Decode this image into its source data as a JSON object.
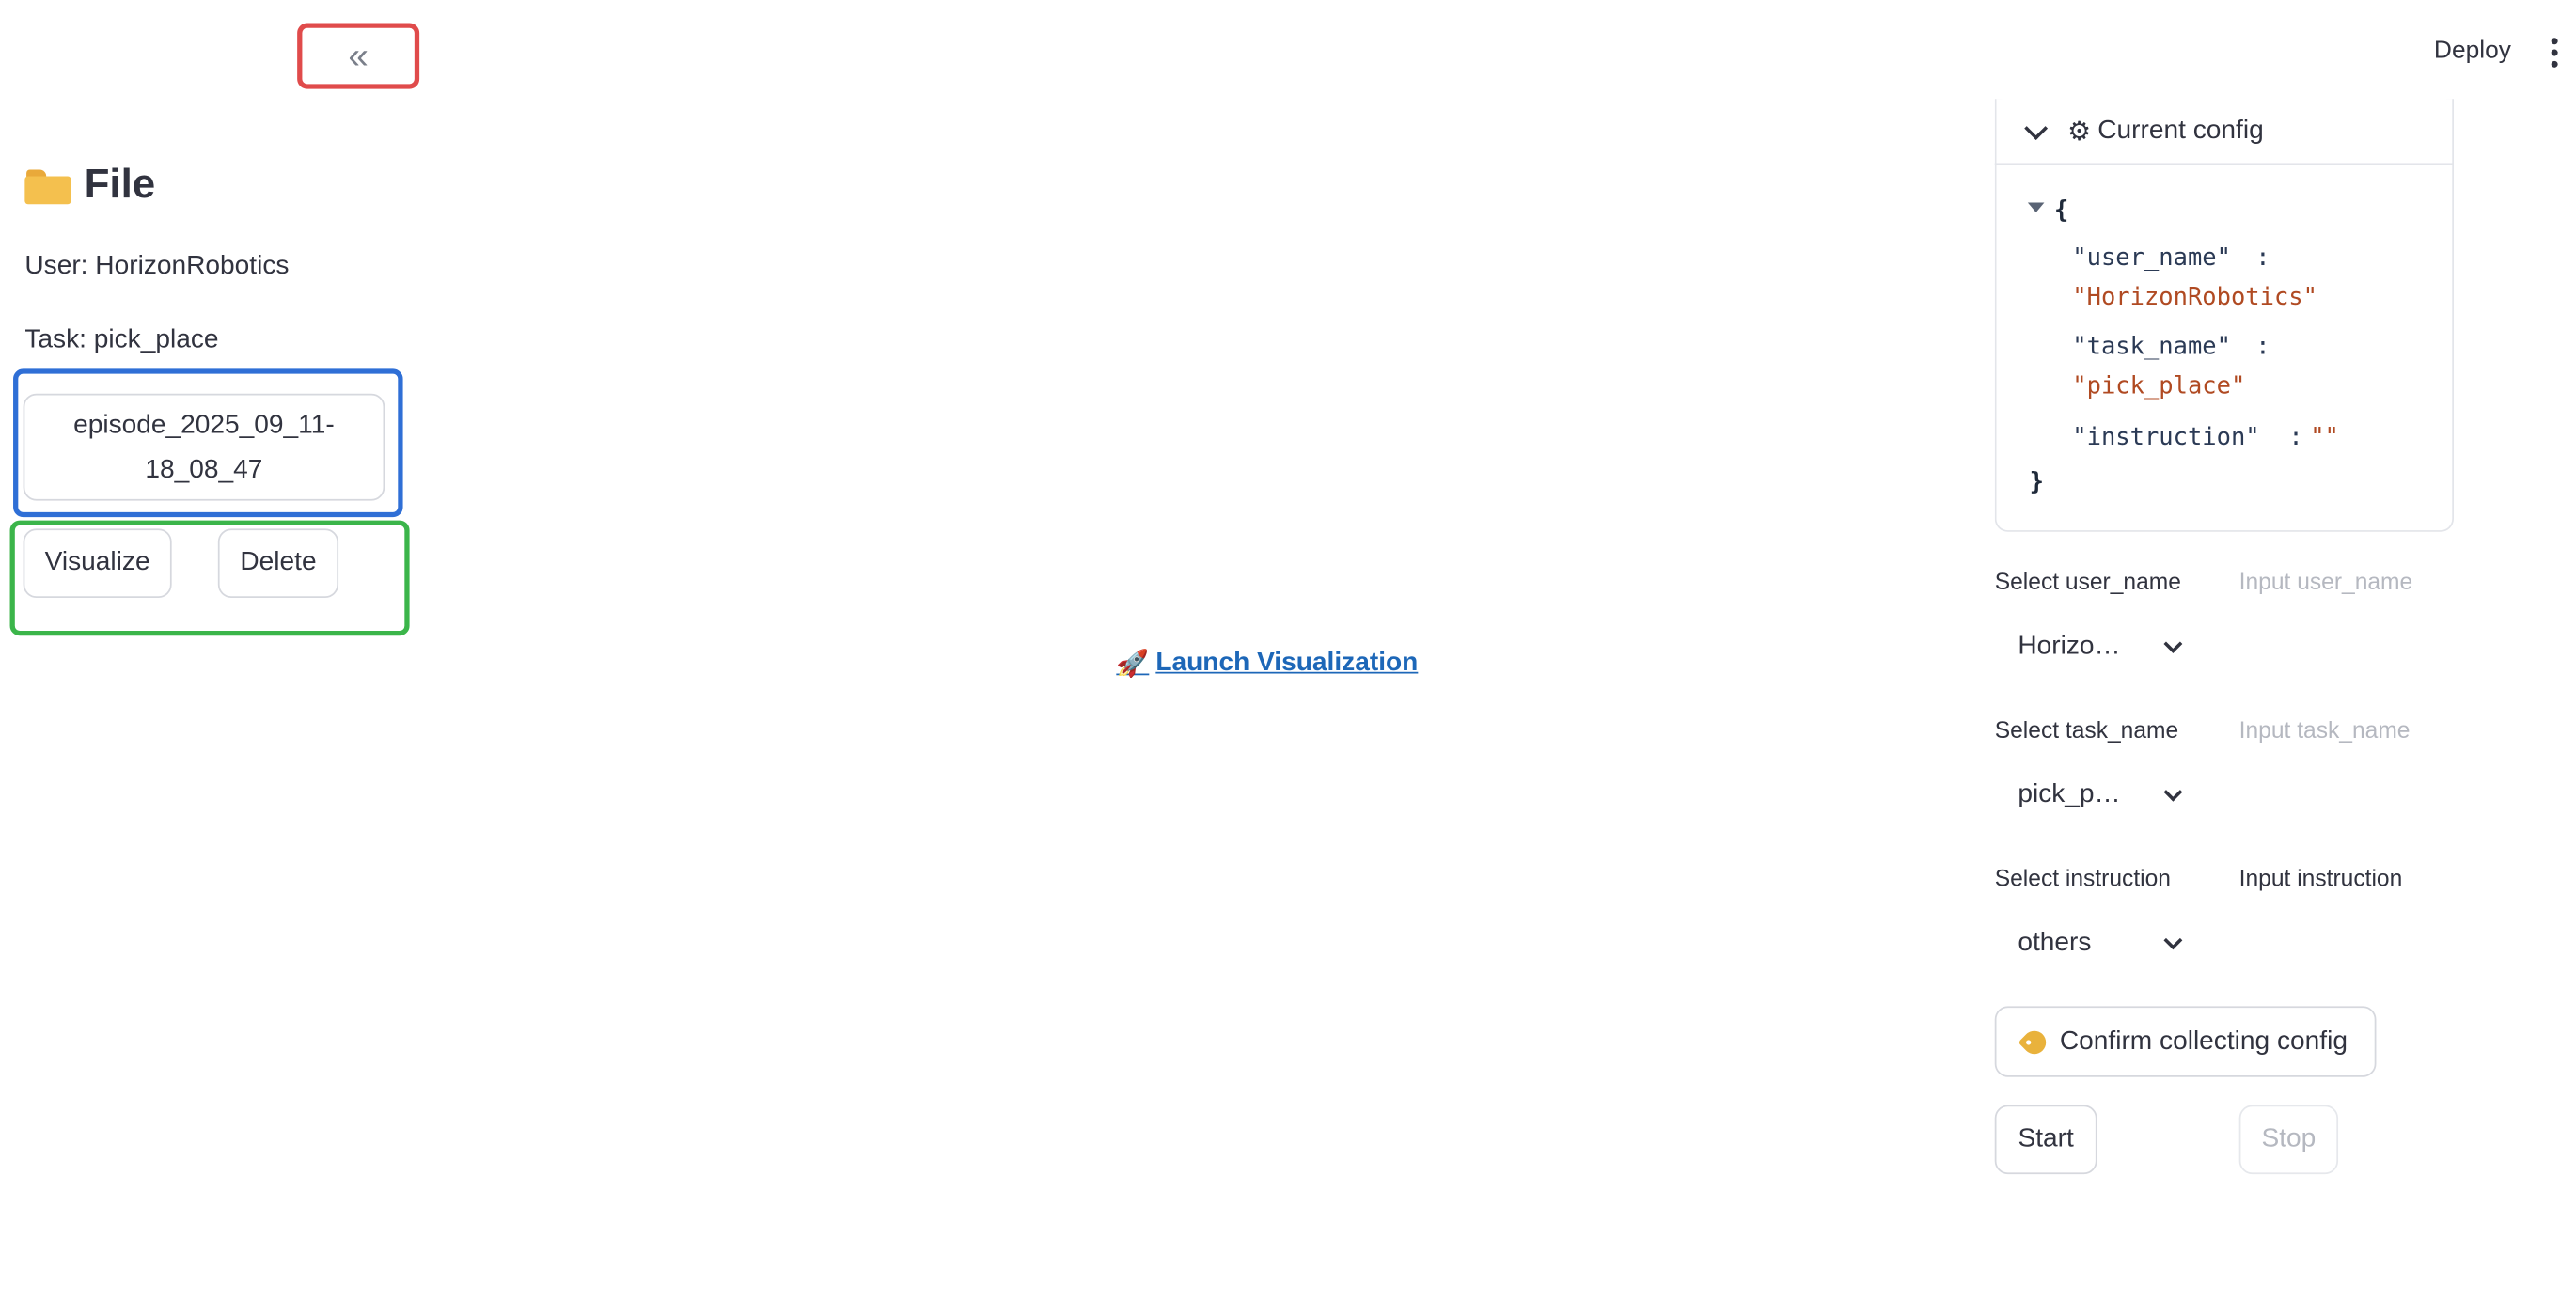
{
  "header": {
    "collapse_label": "«",
    "deploy_label": "Deploy"
  },
  "sidebar": {
    "title": "File",
    "user_line": "User: HorizonRobotics",
    "task_line": "Task: pick_place",
    "episode_line1": "episode_2025_09_11-",
    "episode_line2": "18_08_47",
    "visualize_label": "Visualize",
    "delete_label": "Delete"
  },
  "main": {
    "launch_label": "Launch Visualization",
    "launch_icon": "rocket-icon"
  },
  "config": {
    "header_label": "Current config",
    "json_keys": [
      "\"user_name\"",
      "\"task_name\"",
      "\"instruction\""
    ],
    "json_values": [
      "\"HorizonRobotics\"",
      "\"pick_place\"",
      "\"\""
    ]
  },
  "form": {
    "select_user_label": "Select user_name",
    "input_user_placeholder": "Input user_name",
    "select_user_value": "Horizo…",
    "select_task_label": "Select task_name",
    "input_task_placeholder": "Input task_name",
    "select_task_value": "pick_p…",
    "select_instr_label": "Select instruction",
    "input_instr_label": "Input instruction",
    "select_instr_value": "others",
    "confirm_label": "Confirm collecting config",
    "start_label": "Start",
    "stop_label": "Stop"
  },
  "colors": {
    "red_outline": "#e04b4b",
    "blue_outline": "#2f6fd6",
    "green_outline": "#3bb54a",
    "link": "#1d67b8",
    "json_string": "#b04a22"
  }
}
